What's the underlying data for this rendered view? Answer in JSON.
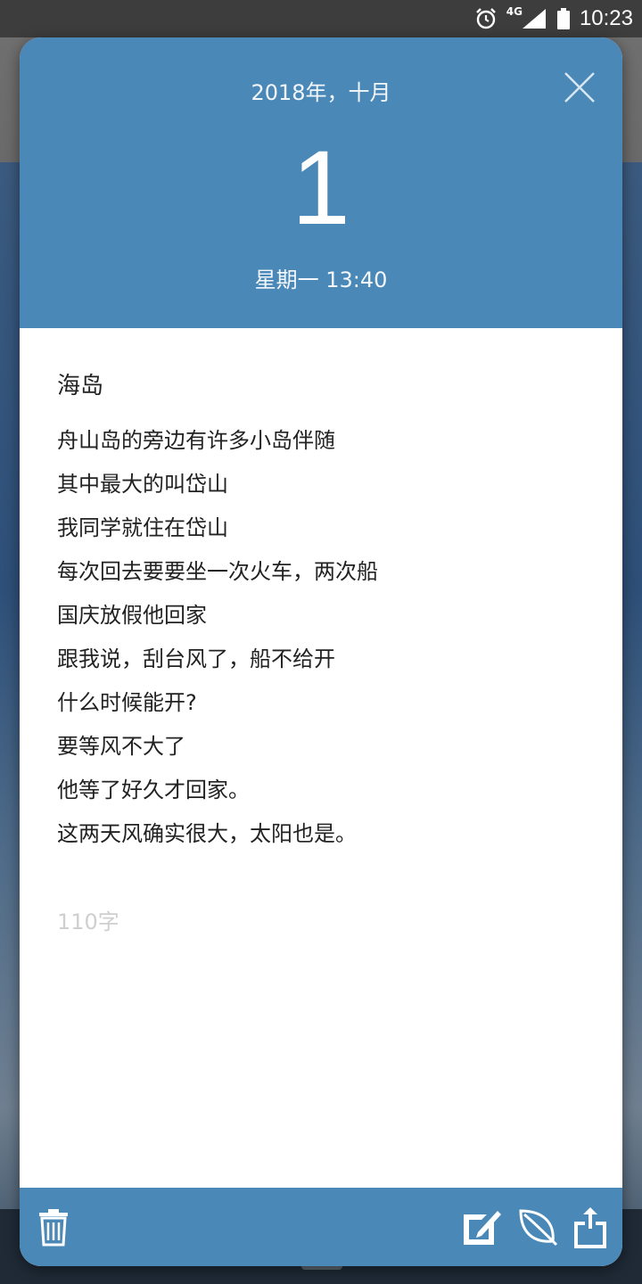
{
  "status_bar": {
    "time": "10:23",
    "network": "4G",
    "icons": [
      "alarm-icon",
      "signal-icon",
      "battery-icon"
    ]
  },
  "diary": {
    "month_year": "2018年，十月",
    "day": "1",
    "weekday_time": "星期一 13:40",
    "title": "海岛",
    "lines": [
      "舟山岛的旁边有许多小岛伴随",
      "其中最大的叫岱山",
      "我同学就住在岱山",
      "每次回去要要坐一次火车，两次船",
      "国庆放假他回家",
      "跟我说，刮台风了，船不给开",
      "什么时候能开?",
      "要等风不大了",
      "他等了好久才回家。",
      "这两天风确实很大，太阳也是。"
    ],
    "word_count": "110字"
  },
  "footer": {
    "icons": [
      "trash-icon",
      "edit-icon",
      "leaf-icon",
      "share-icon"
    ]
  },
  "colors": {
    "accent": "#4a88b8",
    "status_bar": "#3d3d3d",
    "text": "#222222",
    "muted": "#cfcfcf"
  }
}
